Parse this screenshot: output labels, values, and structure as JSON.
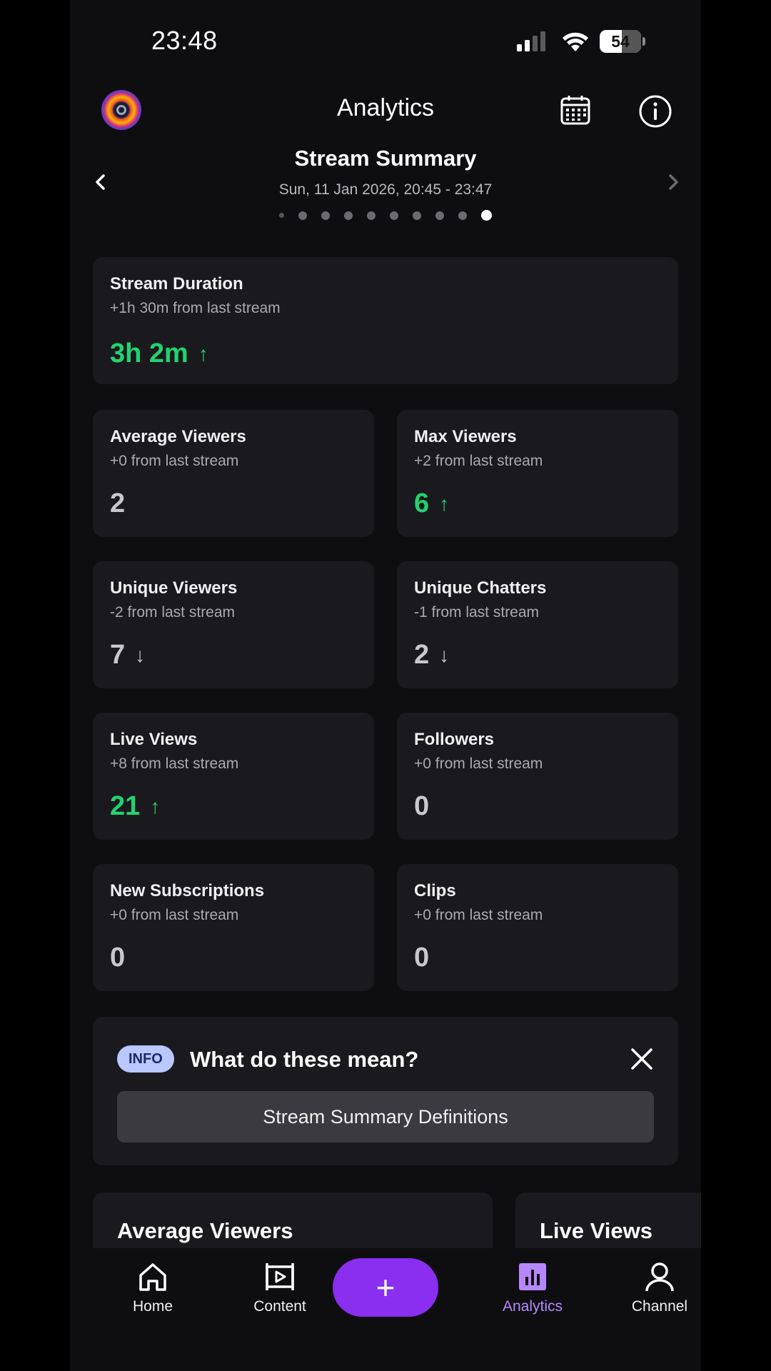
{
  "status_bar": {
    "time": "23:48",
    "battery": "54",
    "battery_level": 0.54
  },
  "header": {
    "title": "Analytics"
  },
  "summary": {
    "title": "Stream Summary",
    "date_range": "Sun, 11 Jan 2026, 20:45 - 23:47",
    "page_count": 10,
    "active_page": 10
  },
  "duration_card": {
    "title": "Stream Duration",
    "sub": "+1h 30m from last stream",
    "value": "3h 2m",
    "trend": "up",
    "arrow": "↑"
  },
  "stats": [
    {
      "title": "Average Viewers",
      "sub": "+0 from last stream",
      "value": "2",
      "trend": "none",
      "arrow": ""
    },
    {
      "title": "Max Viewers",
      "sub": "+2 from last stream",
      "value": "6",
      "trend": "up",
      "arrow": "↑"
    },
    {
      "title": "Unique Viewers",
      "sub": "-2 from last stream",
      "value": "7",
      "trend": "down",
      "arrow": "↓"
    },
    {
      "title": "Unique Chatters",
      "sub": "-1 from last stream",
      "value": "2",
      "trend": "down",
      "arrow": "↓"
    },
    {
      "title": "Live Views",
      "sub": "+8 from last stream",
      "value": "21",
      "trend": "up",
      "arrow": "↑"
    },
    {
      "title": "Followers",
      "sub": "+0 from last stream",
      "value": "0",
      "trend": "none",
      "arrow": ""
    },
    {
      "title": "New Subscriptions",
      "sub": "+0 from last stream",
      "value": "0",
      "trend": "none",
      "arrow": ""
    },
    {
      "title": "Clips",
      "sub": "+0 from last stream",
      "value": "0",
      "trend": "none",
      "arrow": ""
    }
  ],
  "info_card": {
    "badge": "INFO",
    "question": "What do these mean?",
    "button_label": "Stream Summary Definitions"
  },
  "carousel": {
    "cards": [
      "Average Viewers",
      "Live Views"
    ]
  },
  "nav": {
    "home": "Home",
    "content": "Content",
    "create": "+",
    "analytics": "Analytics",
    "channel": "Channel"
  },
  "colors": {
    "accent": "#8a2ef0",
    "positive": "#22d36f",
    "active_nav": "#b787ff"
  }
}
